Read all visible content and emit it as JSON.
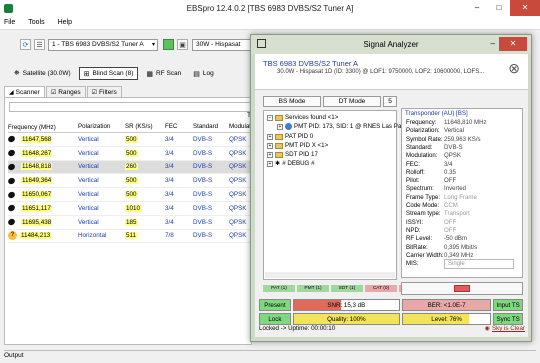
{
  "window": {
    "title": "EBSpro 12.4.0.2 [TBS 6983 DVBS/S2 Tuner A]"
  },
  "menu": [
    "File",
    "Tools",
    "Help"
  ],
  "toolbar": {
    "tuner_value": "1 - TBS 6983 DVBS/S2 Tuner A",
    "satellite_value": "30W - Hispasat"
  },
  "scan_buttons": [
    {
      "label": "Satellite (30.0W)",
      "icon": "satellite-icon"
    },
    {
      "label": "Blind Scan (8)",
      "icon": "blind-scan-icon"
    },
    {
      "label": "RF Scan",
      "icon": "rf-scan-icon"
    },
    {
      "label": "Log",
      "icon": "log-icon"
    }
  ],
  "tabs": [
    {
      "label": "Scanner"
    },
    {
      "label": "Ranges"
    },
    {
      "label": "Filters"
    }
  ],
  "scanner_field_hint": "Ta",
  "table": {
    "columns": [
      "Frequency (MHz)",
      "Polarization",
      "SR (KS/s)",
      "FEC",
      "Standard",
      "Modulation"
    ],
    "rows": [
      {
        "freq": "11647,568",
        "pol": "Vertical",
        "sr": "500",
        "fec": "3/4",
        "std": "DVB-S",
        "mod": "QPSK",
        "icon": "dish-icon",
        "selected": false
      },
      {
        "freq": "11648,267",
        "pol": "Vertical",
        "sr": "500",
        "fec": "3/4",
        "std": "DVB-S",
        "mod": "QPSK",
        "icon": "dish-icon",
        "selected": false
      },
      {
        "freq": "11648,818",
        "pol": "Vertical",
        "sr": "260",
        "fec": "3/4",
        "std": "DVB-S",
        "mod": "QPSK",
        "icon": "dish-icon",
        "selected": true
      },
      {
        "freq": "11649,364",
        "pol": "Vertical",
        "sr": "500",
        "fec": "3/4",
        "std": "DVB-S",
        "mod": "QPSK",
        "icon": "dish-icon",
        "selected": false
      },
      {
        "freq": "11650,067",
        "pol": "Vertical",
        "sr": "500",
        "fec": "3/4",
        "std": "DVB-S",
        "mod": "QPSK",
        "icon": "dish-icon",
        "selected": false
      },
      {
        "freq": "11651,117",
        "pol": "Vertical",
        "sr": "1010",
        "fec": "3/4",
        "std": "DVB-S",
        "mod": "QPSK",
        "icon": "dish-icon",
        "selected": false
      },
      {
        "freq": "11695,438",
        "pol": "Vertical",
        "sr": "185",
        "fec": "3/4",
        "std": "DVB-S",
        "mod": "QPSK",
        "icon": "dish-icon",
        "selected": false
      },
      {
        "freq": "11484,213",
        "pol": "Horizontal",
        "sr": "511",
        "fec": "7/8",
        "std": "DVB-S",
        "mod": "QPSK",
        "icon": "warning-icon",
        "selected": false
      }
    ]
  },
  "output_label": "Output",
  "analyzer": {
    "title": "Signal Analyzer",
    "device_name": "TBS 6983 DVBS/S2 Tuner A",
    "device_detail": "30.0W - Hispasat 1D (ID: 3300) @ LOF1: 9750000, LOF2: 10600000, LOFS...",
    "mode_buttons": [
      "BS Mode",
      "DT Mode",
      "5"
    ],
    "tree": [
      {
        "label": "Services found <1>",
        "type": "folder"
      },
      {
        "label": "PMT PID: 173, SID: 1 @ RNES Las Palmas",
        "type": "service"
      },
      {
        "label": "PAT PID 0",
        "type": "folder"
      },
      {
        "label": "PMT PID X <1>",
        "type": "folder"
      },
      {
        "label": "SDT PID 17",
        "type": "folder"
      },
      {
        "label": "# DEBUG #",
        "type": "debug"
      }
    ],
    "tags": [
      {
        "label": "PAT (1)",
        "color": "#9fd79f"
      },
      {
        "label": "PMT (1)",
        "color": "#9fd79f"
      },
      {
        "label": "SDT (1)",
        "color": "#9fd79f"
      },
      {
        "label": "CAT (0)",
        "color": "#e8a8a8"
      },
      {
        "label": "NIT (0)",
        "color": "#e8a8a8"
      }
    ],
    "props_group": "Transponder (AU) [BS]",
    "props": [
      {
        "key": "Frequency:",
        "val": "11648,810 MHz",
        "dim": false
      },
      {
        "key": "Polarization:",
        "val": "Vertical",
        "dim": false
      },
      {
        "key": "Symbol Rate:",
        "val": "259,963 KS/s",
        "dim": false
      },
      {
        "key": "Standard:",
        "val": "DVB-S",
        "dim": false
      },
      {
        "key": "Modulation:",
        "val": "QPSK",
        "dim": false
      },
      {
        "key": "FEC:",
        "val": "3/4",
        "dim": false
      },
      {
        "key": "Rolloff:",
        "val": "0.35",
        "dim": false
      },
      {
        "key": "Pilot:",
        "val": "OFF",
        "dim": false
      },
      {
        "key": "Spectrum:",
        "val": "Inverted",
        "dim": false
      },
      {
        "key": "Frame Type:",
        "val": "Long Frame",
        "dim": true
      },
      {
        "key": "Code Mode:",
        "val": "CCM",
        "dim": true
      },
      {
        "key": "Stream type:",
        "val": "Transport",
        "dim": true
      },
      {
        "key": "ISSYI:",
        "val": "OFF",
        "dim": true
      },
      {
        "key": "NPD:",
        "val": "OFF",
        "dim": true
      },
      {
        "key": "RF Level:",
        "val": "-50 dBm",
        "dim": false
      },
      {
        "key": "BitRate:",
        "val": "0,395 Mbit/s",
        "dim": false
      },
      {
        "key": "Carrier Width:",
        "val": "0,349 MHz",
        "dim": false
      }
    ],
    "mis_label": "MIS:",
    "mis_value": "Single",
    "present_label": "Present",
    "lock_label": "Lock",
    "snr_label": "SNR: 15,3 dB",
    "snr_fill_percent": 45,
    "quality_label": "Quality: 100%",
    "quality_fill_percent": 100,
    "ber_label": "BER: <1.0E-7",
    "level_label": "Level: 76%",
    "level_fill_percent": 76,
    "input_ts_label": "Input TS",
    "sync_ts_label": "Sync TS",
    "status_text": "Locked -> Uptime: 00:00:10",
    "sky_link": "Sky is Clear"
  }
}
